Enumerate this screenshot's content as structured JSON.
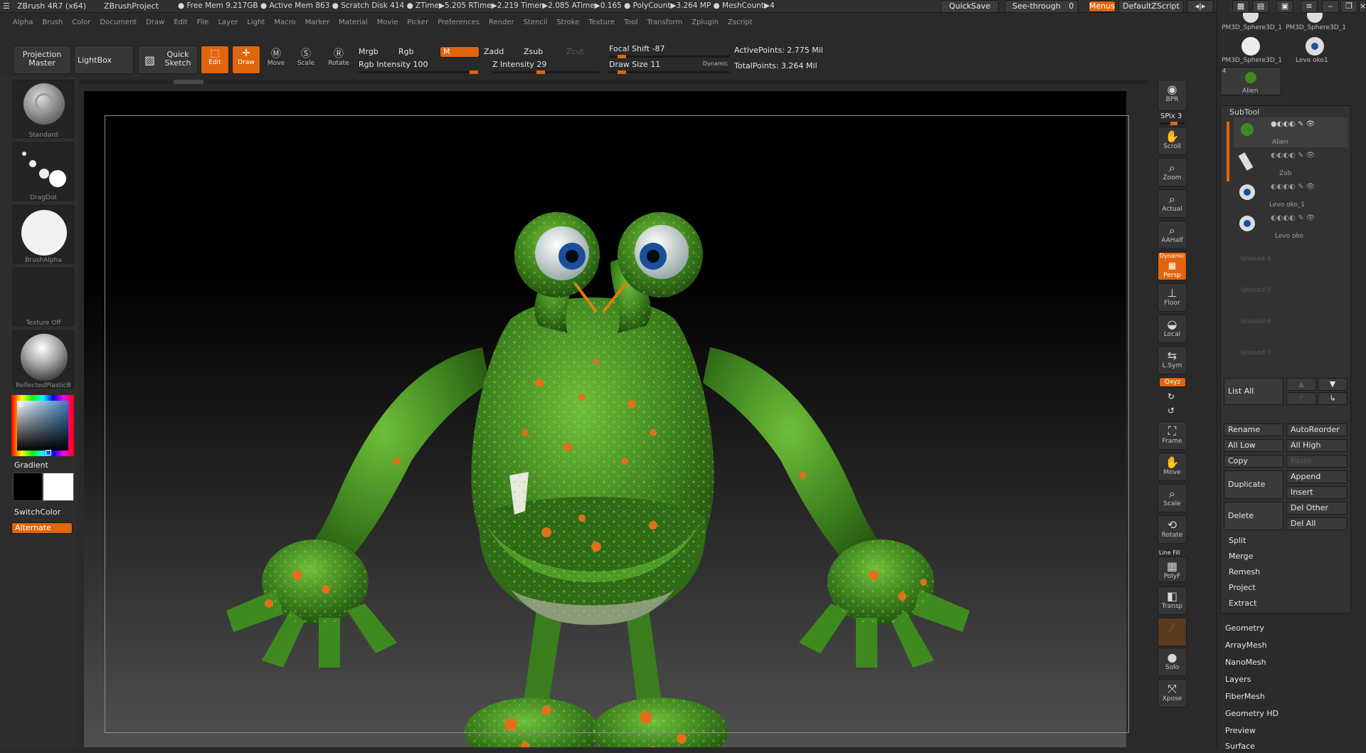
{
  "title": {
    "app": "ZBrush 4R7 (x64)",
    "project": "ZBrushProject",
    "stats": "● Free Mem 9.217GB ● Active Mem 863 ● Scratch Disk 414 ● ZTime▶5.205 RTime▶2.219 Timer▶2.085 ATime▶0.165 ● PolyCount▶3.264 MP ● MeshCount▶4",
    "quicksave": "QuickSave",
    "see_through": "See-through",
    "see_through_value": "0",
    "menus": "Menus",
    "script": "DefaultZScript"
  },
  "menu": [
    "Alpha",
    "Brush",
    "Color",
    "Document",
    "Draw",
    "Edit",
    "File",
    "Layer",
    "Light",
    "Macro",
    "Marker",
    "Material",
    "Movie",
    "Picker",
    "Preferences",
    "Render",
    "Stencil",
    "Stroke",
    "Texture",
    "Tool",
    "Transform",
    "Zplugin",
    "Zscript"
  ],
  "shelf": {
    "projection_master": "Projection Master",
    "lightbox": "LightBox",
    "quick_sketch": "Quick Sketch",
    "edit": "Edit",
    "draw": "Draw",
    "move": "Move",
    "scale": "Scale",
    "rotate": "Rotate",
    "mrgb": "Mrgb",
    "rgb": "Rgb",
    "m": "M",
    "zadd": "Zadd",
    "zsub": "Zsub",
    "zcut": "Zcut",
    "rgb_intensity_label": "Rgb Intensity",
    "rgb_intensity_value": "100",
    "z_intensity_label": "Z Intensity",
    "z_intensity_value": "29",
    "focal_shift_label": "Focal Shift",
    "focal_shift_value": "-87",
    "draw_size_label": "Draw Size",
    "draw_size_value": "11",
    "dynamic": "Dynamic",
    "active_points": "ActivePoints: 2.775 Mil",
    "total_points": "TotalPoints: 3.264 Mil"
  },
  "left": {
    "brush": "Standard",
    "stroke": "DragDot",
    "alpha": "BrushAlpha",
    "texture": "Texture Off",
    "material": "ReflectedPlasticB",
    "gradient": "Gradient",
    "switch_color": "SwitchColor",
    "alternate": "Alternate"
  },
  "right": {
    "bpr": "BPR",
    "spix": "SPix 3",
    "buttons": [
      "Scroll",
      "Zoom",
      "Actual",
      "AAHalf",
      "Persp",
      "Floor",
      "Local",
      "L.Sym",
      "Frame",
      "Move",
      "Scale",
      "Rotate",
      "PolyF",
      "Transp",
      "Solo",
      "Xpose"
    ],
    "dynamic": "Dynamic",
    "xyz": "Qxyz",
    "line_fill": "Line Fill"
  },
  "tray": {
    "thumbs": [
      "PM3D_Sphere3D_1",
      "PM3D_Sphere3D_1",
      "PM3D_Sphere3D_1",
      "Levo oko1",
      "Alien"
    ],
    "subtool": "SubTool",
    "subtools": [
      "Alien",
      "Zob",
      "Levo oko_1",
      "Levo oko"
    ],
    "unused": [
      "Unused 4",
      "Unused 5",
      "Unused 6",
      "Unused 7"
    ],
    "list_all": "List All",
    "rename": "Rename",
    "autoreorder": "AutoReorder",
    "all_low": "All Low",
    "all_high": "All High",
    "copy": "Copy",
    "paste": "Paste",
    "duplicate": "Duplicate",
    "append": "Append",
    "insert": "Insert",
    "delete": "Delete",
    "del_other": "Del Other",
    "del_all": "Del All",
    "actions": [
      "Split",
      "Merge",
      "Remesh",
      "Project",
      "Extract"
    ],
    "sections": [
      "Geometry",
      "ArrayMesh",
      "NanoMesh",
      "Layers",
      "FiberMesh",
      "Geometry HD",
      "Preview",
      "Surface"
    ]
  },
  "colors": {
    "accent": "#e0650d",
    "creature": "#3f8a1f",
    "spots": "#e0701a"
  },
  "thumb_index": "4"
}
